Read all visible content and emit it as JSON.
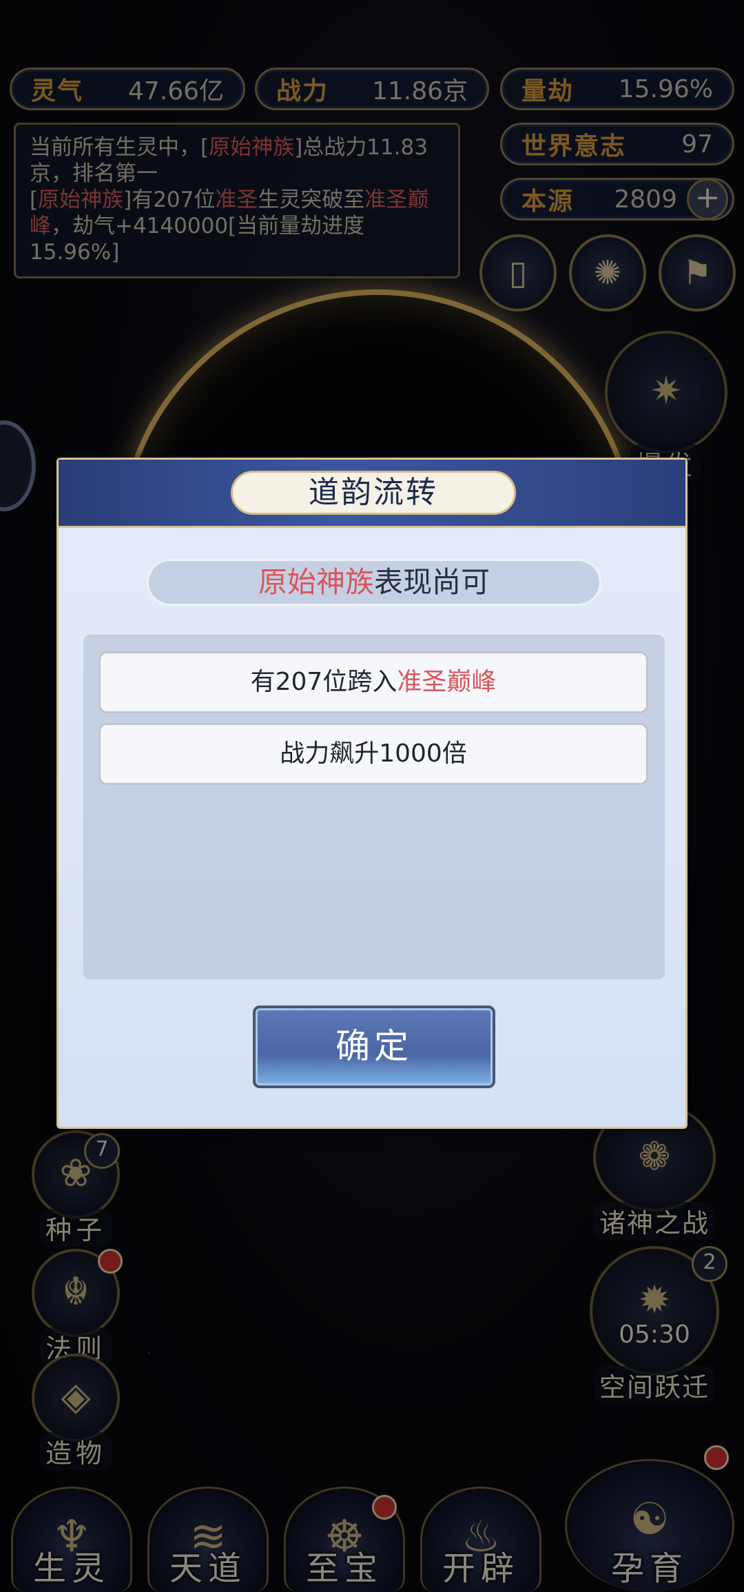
{
  "stats": {
    "lingqi": {
      "label": "灵气",
      "value": "47.66亿"
    },
    "zhanli": {
      "label": "战力",
      "value": "11.86京"
    },
    "liangjie": {
      "label": "量劫",
      "value": "15.96%"
    },
    "shijie": {
      "label": "世界意志",
      "value": "97"
    },
    "benyuan": {
      "label": "本源",
      "value": "2809",
      "plus": "+"
    }
  },
  "news": {
    "line1_a": "当前所有生灵中，[",
    "line1_race": "原始神族",
    "line1_b": "]总战力11.83京，排名第一",
    "line2_a": "[",
    "line2_race": "原始神族",
    "line2_b": "]有207位",
    "line2_rank": "准圣",
    "line2_c": "生灵突破至",
    "line2_rank2": "准圣巅峰",
    "line2_d": "，劫气+4140000[当前量劫进度15.96%]"
  },
  "side_left": [
    {
      "label": "种子",
      "badge": "7"
    },
    {
      "label": "法则"
    },
    {
      "label": "造物"
    }
  ],
  "side_right": {
    "baofa": "爆发",
    "zhushen": "诸神之战",
    "kongjian": "空间跃迁",
    "kongjian_badge": "2",
    "timer": "05:30",
    "yunyu": "孕育"
  },
  "bottom_nav": [
    "生灵",
    "天道",
    "至宝",
    "开辟"
  ],
  "modal": {
    "title": "道韵流转",
    "subtitle_race": "原始神族",
    "subtitle_rest": "表现尚可",
    "rows": [
      {
        "text": "有207位跨入",
        "highlight": "准圣巅峰"
      },
      {
        "text": "战力飙升1000倍",
        "highlight": ""
      }
    ],
    "confirm": "确定"
  },
  "colors": {
    "accent_red": "#d9575b",
    "gold": "#d9b25c",
    "header_blue": "#3c57a0"
  }
}
